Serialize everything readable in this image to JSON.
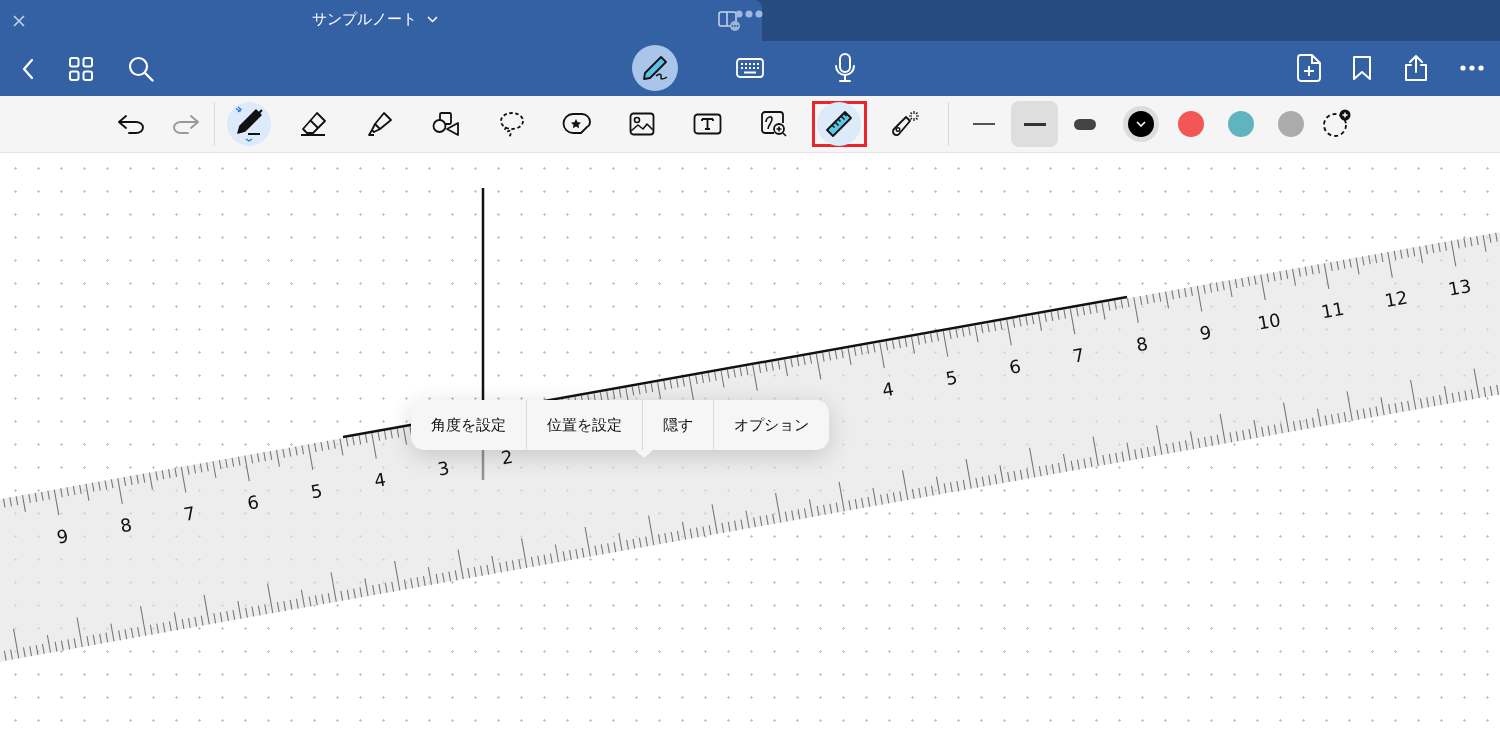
{
  "window": {
    "title": "サンプルノート"
  },
  "modes": [
    {
      "kind": "pen",
      "selected": true
    },
    {
      "kind": "keyboard",
      "selected": false
    },
    {
      "kind": "microphone",
      "selected": false
    }
  ],
  "history": [
    {
      "kind": "undo",
      "disabled": false
    },
    {
      "kind": "redo",
      "disabled": true
    }
  ],
  "tools": [
    {
      "kind": "pen",
      "selected": true,
      "outlined": false
    },
    {
      "kind": "eraser",
      "selected": false,
      "outlined": false
    },
    {
      "kind": "highlighter",
      "selected": false,
      "outlined": false
    },
    {
      "kind": "shapes",
      "selected": false,
      "outlined": false
    },
    {
      "kind": "lasso",
      "selected": false,
      "outlined": false
    },
    {
      "kind": "sticker",
      "selected": false,
      "outlined": false
    },
    {
      "kind": "image",
      "selected": false,
      "outlined": false
    },
    {
      "kind": "text",
      "selected": false,
      "outlined": false
    },
    {
      "kind": "image-zoom",
      "selected": false,
      "outlined": false
    },
    {
      "kind": "ruler",
      "selected": true,
      "outlined": true
    },
    {
      "kind": "laser",
      "selected": false,
      "outlined": false
    }
  ],
  "stroke_widths": [
    {
      "kind": "thin",
      "selected": false
    },
    {
      "kind": "medium",
      "selected": true
    },
    {
      "kind": "thick",
      "selected": false
    }
  ],
  "colors": [
    {
      "color": "#000000",
      "selected": true
    },
    {
      "color": "#f25656",
      "selected": false
    },
    {
      "color": "#5fb4bf",
      "selected": false
    },
    {
      "color": "#ababab",
      "selected": false
    }
  ],
  "ruler": {
    "left_labels": [
      "9",
      "8",
      "7",
      "6",
      "5",
      "4",
      "3",
      "2"
    ],
    "right_labels": [
      "4",
      "5",
      "6",
      "7",
      "8",
      "9",
      "10",
      "11",
      "12",
      "13"
    ]
  },
  "menu": {
    "items": [
      "角度を設定",
      "位置を設定",
      "隠す",
      "オプション"
    ]
  }
}
